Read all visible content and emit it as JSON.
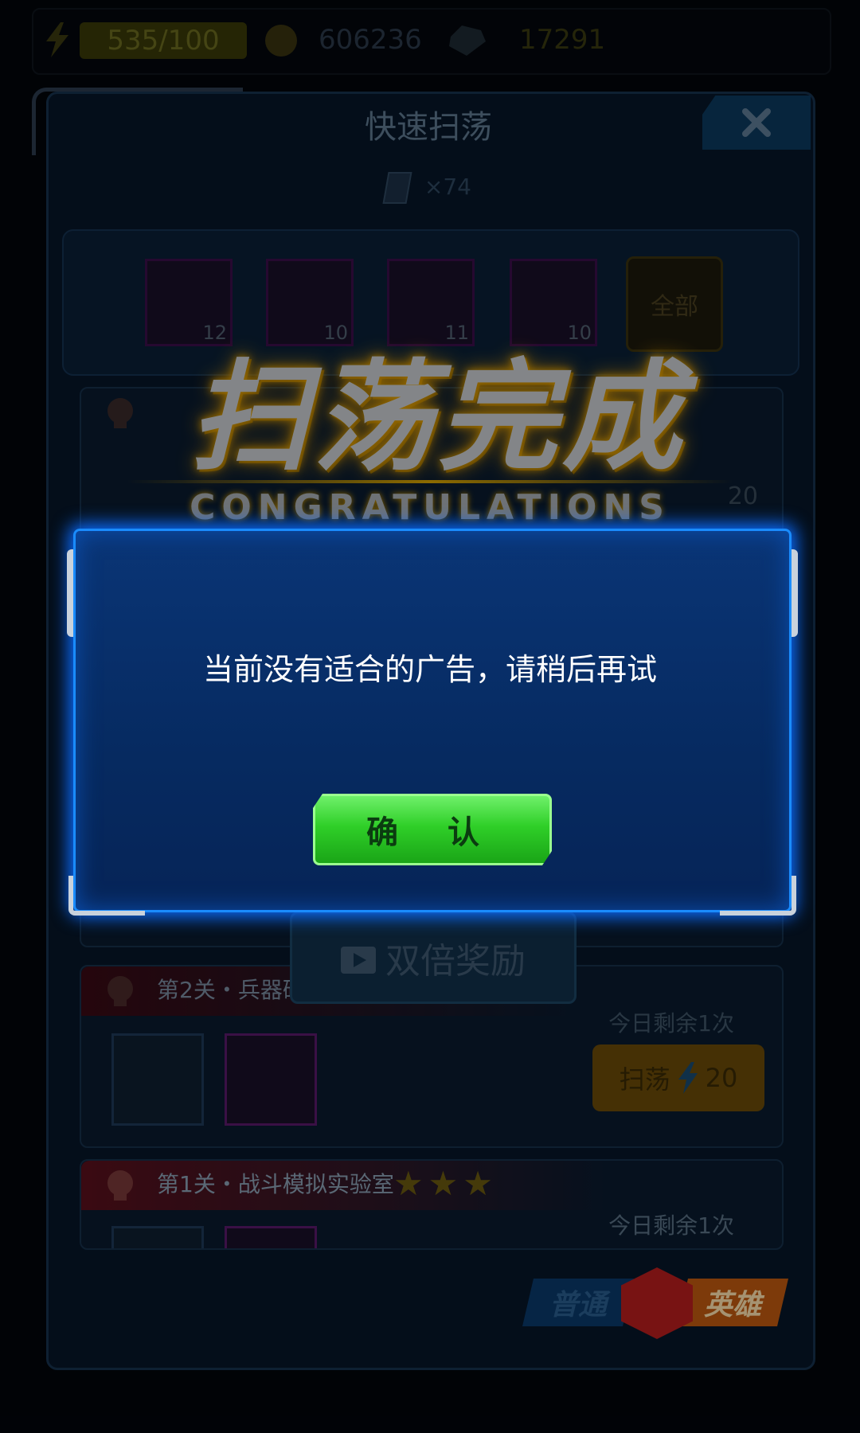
{
  "resources": {
    "energy": "535/100",
    "gold": "606236",
    "gems": "17291"
  },
  "panel": {
    "title": "快速扫荡",
    "ticket_count": "×74",
    "rewards": [
      "12",
      "10",
      "11",
      "10"
    ],
    "all_button": "全部"
  },
  "banner": {
    "title": "扫荡完成",
    "subtitle": "CONGRATULATIONS",
    "hidden_count": "20"
  },
  "double_reward": "双倍奖励",
  "levels": [
    {
      "title": "第2关・兵器研",
      "remain": "今日剩余1次",
      "sweep": "扫荡",
      "cost": "20"
    },
    {
      "title": "第1关・战斗模拟实验室",
      "remain": "今日剩余1次",
      "stars": "★★★"
    }
  ],
  "tabs": {
    "normal": "普通",
    "hero": "英雄"
  },
  "dialog": {
    "message": "当前没有适合的广告，请稍后再试",
    "confirm": "确 认"
  },
  "colors": {
    "dialog_border": "#1a8cff",
    "confirm_green": "#2fcf28",
    "banner_glow": "#e09a00"
  }
}
